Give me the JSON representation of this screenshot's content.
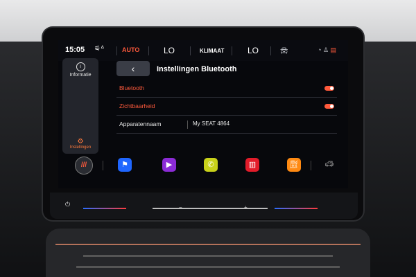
{
  "status": {
    "time": "15:05",
    "seat_heating_icon": "seat-heating-icon",
    "auto_label": "AUTO",
    "left_temp": "LO",
    "climate_label": "KLIMAAT",
    "right_temp": "LO"
  },
  "sidebar": {
    "info_label": "Informatie",
    "settings_label": "Instellingen"
  },
  "panel": {
    "title": "Instellingen Bluetooth",
    "rows": [
      {
        "label": "Bluetooth",
        "toggle_on": true
      },
      {
        "label": "Zichtbaarheid",
        "toggle_on": true
      },
      {
        "label": "Apparatennaam",
        "value": "My SEAT 4864"
      }
    ]
  },
  "dock": {
    "home_label": "///",
    "apps": [
      {
        "icon": "flag-icon",
        "color": "#1f66ff"
      },
      {
        "icon": "play-icon",
        "color": "#8b2bd6"
      },
      {
        "icon": "phone-icon",
        "color": "#c8d11a"
      },
      {
        "icon": "radio-icon",
        "color": "#e21c2a"
      },
      {
        "icon": "fuel-icon",
        "color": "#ff8a12"
      }
    ]
  },
  "colors": {
    "accent": "#ff5a3c"
  }
}
